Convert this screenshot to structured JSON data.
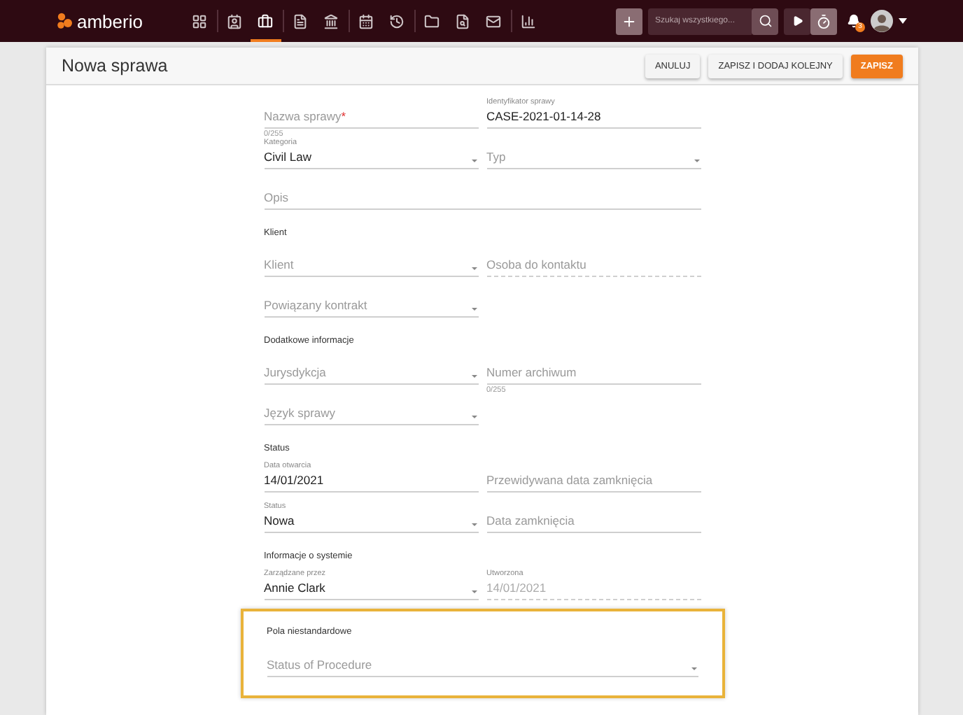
{
  "nav": {
    "logo": "amberio",
    "items": [
      {
        "selected": false
      },
      {
        "selected": false
      },
      {
        "selected": true
      },
      {
        "selected": false
      },
      {
        "selected": false
      },
      {
        "selected": false
      },
      {
        "selected": false
      },
      {
        "selected": false
      },
      {
        "selected": false
      },
      {
        "selected": false
      },
      {
        "selected": false
      }
    ],
    "search": {
      "placeholder": "Szukaj wszystkiego..."
    },
    "notifications": "3"
  },
  "header": {
    "title": "Nowa sprawa",
    "buttons": [
      {
        "label": "ANULUJ",
        "kind": "secondary"
      },
      {
        "label": "ZAPISZ I DODAJ KOLEJNY",
        "kind": "secondary"
      },
      {
        "label": "ZAPISZ",
        "kind": "primary"
      }
    ]
  },
  "sections": [
    {
      "highlighted": false,
      "rows": [
        [
          {
            "kind": "text",
            "placeholder": "Nazwa sprawy",
            "required_mark": "*",
            "counter": "0/255"
          },
          {
            "kind": "text",
            "label": "Identyfikator sprawy",
            "value": "CASE-2021-01-14-28"
          }
        ],
        [
          {
            "kind": "select",
            "label": "Kategoria",
            "value": "Civil Law"
          },
          {
            "kind": "select",
            "placeholder": "Typ"
          }
        ],
        [
          {
            "kind": "text",
            "placeholder": "Opis",
            "wide": true
          }
        ]
      ]
    },
    {
      "title": "Klient",
      "highlighted": false,
      "rows": [
        [
          {
            "kind": "select",
            "placeholder": "Klient"
          },
          {
            "kind": "text",
            "placeholder": "Osoba do kontaktu",
            "disabled": true
          }
        ],
        [
          {
            "kind": "select",
            "placeholder": "Powiązany kontrakt"
          }
        ]
      ]
    },
    {
      "title": "Dodatkowe informacje",
      "highlighted": false,
      "rows": [
        [
          {
            "kind": "select",
            "placeholder": "Jurysdykcja"
          },
          {
            "kind": "text",
            "placeholder": "Numer archiwum",
            "counter": "0/255"
          }
        ],
        [
          {
            "kind": "select",
            "placeholder": "Język sprawy"
          }
        ]
      ]
    },
    {
      "title": "Status",
      "highlighted": false,
      "rows": [
        [
          {
            "kind": "text",
            "label": "Data otwarcia",
            "value": "14/01/2021"
          },
          {
            "kind": "text",
            "placeholder": "Przewidywana data zamknięcia"
          }
        ],
        [
          {
            "kind": "select",
            "label": "Status",
            "value": "Nowa"
          },
          {
            "kind": "text",
            "placeholder": "Data zamknięcia"
          }
        ]
      ]
    },
    {
      "title": "Informacje o systemie",
      "highlighted": false,
      "rows": [
        [
          {
            "kind": "select",
            "label": "Zarządzane przez",
            "value": "Annie Clark"
          },
          {
            "kind": "text",
            "label": "Utworzona",
            "value": "14/01/2021",
            "disabled": true
          }
        ]
      ]
    },
    {
      "title": "Pola niestandardowe",
      "highlighted": true,
      "rows": [
        [
          {
            "kind": "select",
            "placeholder": "Status of Procedure",
            "wide": true
          }
        ]
      ]
    }
  ]
}
